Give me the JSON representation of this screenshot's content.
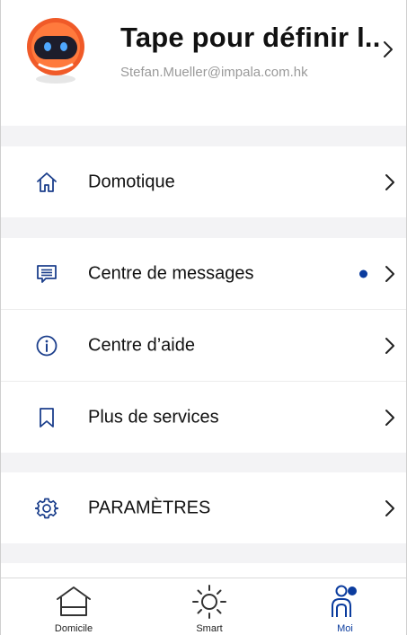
{
  "profile": {
    "name": "Tape pour définir l...",
    "email": "Stefan.Mueller@impala.com.hk"
  },
  "menu": [
    {
      "label": "Domotique",
      "icon": "home-icon"
    },
    {
      "label": "Centre de messages",
      "icon": "message-icon",
      "badge": true
    },
    {
      "label": "Centre d’aide",
      "icon": "info-icon"
    },
    {
      "label": "Plus de services",
      "icon": "bookmark-icon"
    },
    {
      "label": "PARAMÈTRES",
      "icon": "gear-icon"
    }
  ],
  "tabs": [
    {
      "label": "Domicile",
      "icon": "home-icon",
      "active": false
    },
    {
      "label": "Smart",
      "icon": "sun-icon",
      "active": false
    },
    {
      "label": "Moi",
      "icon": "user-icon",
      "active": true
    }
  ],
  "colors": {
    "accent": "#0b3c9e",
    "icon": "#1c3f8c",
    "avatar": "#f05a28",
    "separator": "#f3f3f5"
  }
}
